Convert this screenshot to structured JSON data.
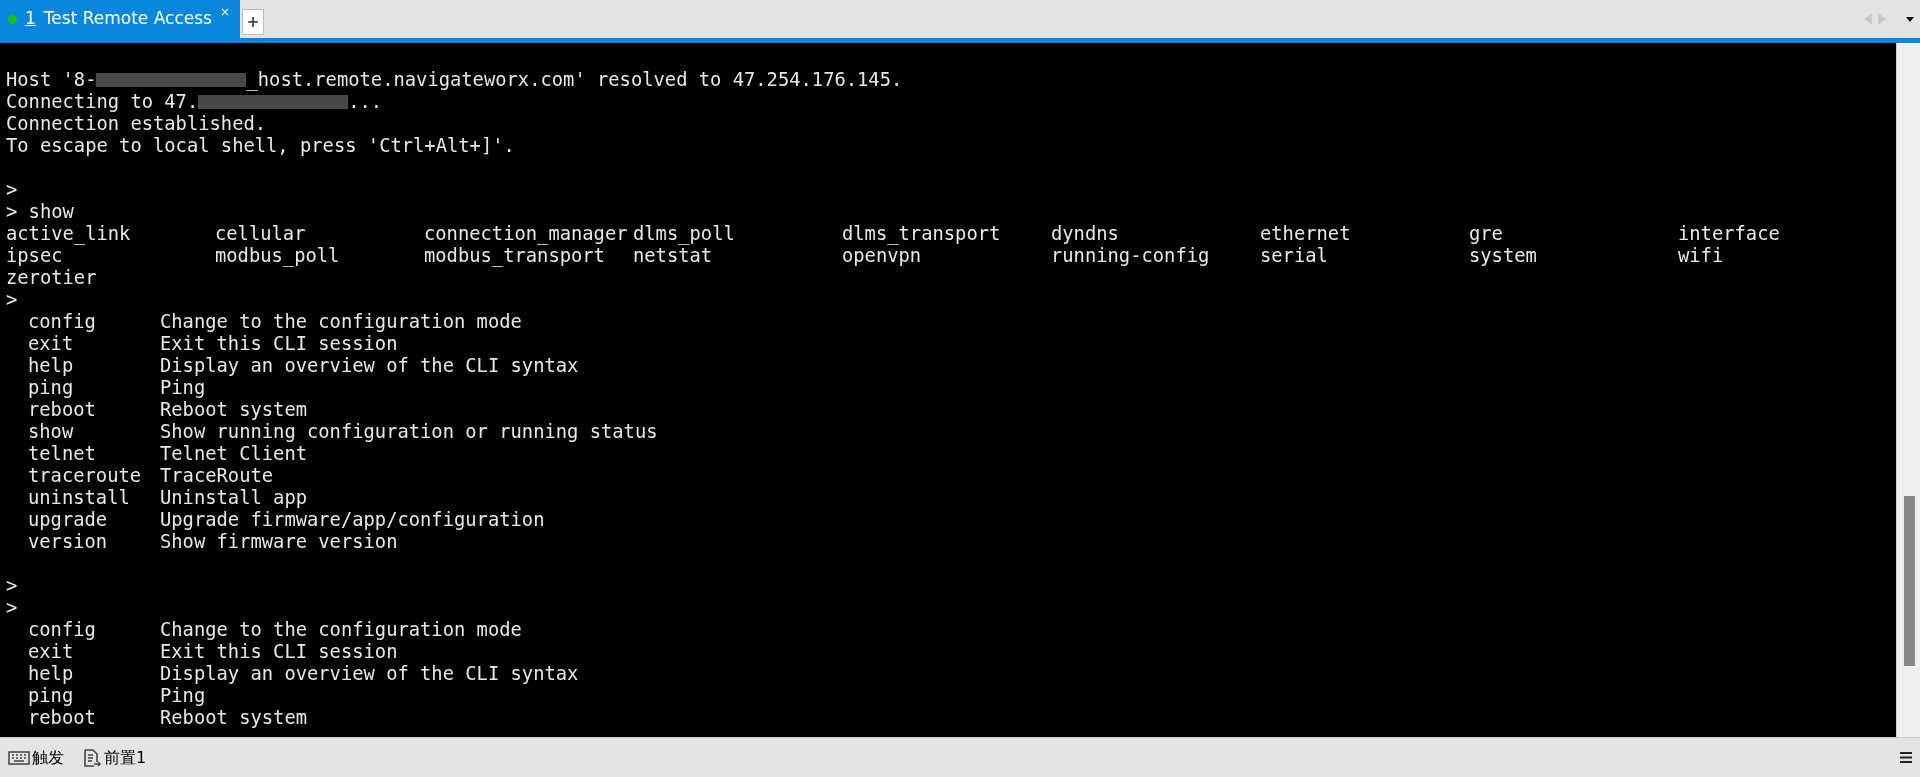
{
  "tabs": [
    {
      "number": "1",
      "title": "Test Remote Access",
      "close": "×",
      "selected": true,
      "connected": true
    }
  ],
  "new_tab": "+",
  "terminal": {
    "lines": [
      {
        "kind": "blank"
      },
      {
        "kind": "redacted",
        "before": "Host '8-",
        "after": "_host.remote.navigateworx.com' resolved to 47.254.176.145."
      },
      {
        "kind": "redacted",
        "before": "Connecting to 47.",
        "after": "..."
      },
      {
        "kind": "text",
        "text": "Connection established."
      },
      {
        "kind": "text",
        "text": "To escape to local shell, press 'Ctrl+Alt+]'."
      },
      {
        "kind": "blank"
      },
      {
        "kind": "text",
        "text": ">"
      },
      {
        "kind": "text",
        "text": "> show"
      },
      {
        "kind": "columns",
        "cells": [
          "active_link",
          "cellular",
          "connection_manager",
          "dlms_poll",
          "dlms_transport",
          "dyndns",
          "ethernet",
          "gre",
          "interface"
        ]
      },
      {
        "kind": "columns",
        "cells": [
          "ipsec",
          "modbus_poll",
          "modbus_transport",
          "netstat",
          "openvpn",
          "running-config",
          "serial",
          "system",
          "wifi"
        ]
      },
      {
        "kind": "columns",
        "cells": [
          "zerotier"
        ]
      },
      {
        "kind": "text",
        "text": ">"
      },
      {
        "kind": "help",
        "command": "config",
        "description": "Change to the configuration mode"
      },
      {
        "kind": "help",
        "command": "exit",
        "description": "Exit this CLI session"
      },
      {
        "kind": "help",
        "command": "help",
        "description": "Display an overview of the CLI syntax"
      },
      {
        "kind": "help",
        "command": "ping",
        "description": "Ping"
      },
      {
        "kind": "help",
        "command": "reboot",
        "description": "Reboot system"
      },
      {
        "kind": "help",
        "command": "show",
        "description": "Show running configuration or running status"
      },
      {
        "kind": "help",
        "command": "telnet",
        "description": "Telnet Client"
      },
      {
        "kind": "help",
        "command": "traceroute",
        "description": "TraceRoute"
      },
      {
        "kind": "help",
        "command": "uninstall",
        "description": "Uninstall app"
      },
      {
        "kind": "help",
        "command": "upgrade",
        "description": "Upgrade firmware/app/configuration"
      },
      {
        "kind": "help",
        "command": "version",
        "description": "Show firmware version"
      },
      {
        "kind": "blank"
      },
      {
        "kind": "text",
        "text": ">"
      },
      {
        "kind": "text",
        "text": ">"
      },
      {
        "kind": "help",
        "command": "config",
        "description": "Change to the configuration mode"
      },
      {
        "kind": "help",
        "command": "exit",
        "description": "Exit this CLI session"
      },
      {
        "kind": "help",
        "command": "help",
        "description": "Display an overview of the CLI syntax"
      },
      {
        "kind": "help",
        "command": "ping",
        "description": "Ping"
      },
      {
        "kind": "help",
        "command": "reboot",
        "description": "Reboot system"
      }
    ]
  },
  "status_bar": {
    "items": [
      {
        "kind": "keyboard",
        "label": "触发"
      },
      {
        "kind": "document",
        "label": "前置1"
      }
    ]
  }
}
